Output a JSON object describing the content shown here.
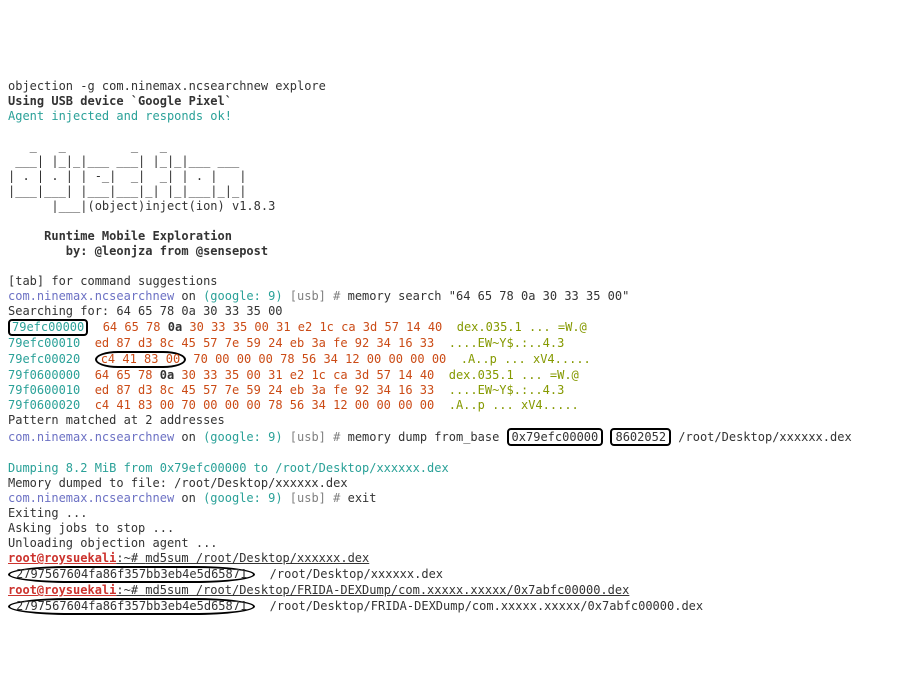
{
  "cmd_line": "objection -g com.ninemax.ncsearchnew explore",
  "usb_device": "Using USB device `Google Pixel`",
  "agent_ok": "Agent injected and responds ok!",
  "ascii": [
    "   _   _         _   _",
    " ___| |_|_|___ ___| |_|_|___ ___",
    "| . | . | | -_|  _|  _| | . |   |",
    "|___|___| |___|___|_| |_|___|_|_|",
    "      |___|(object)inject(ion) v1.8.3"
  ],
  "runtime_title": "     Runtime Mobile Exploration",
  "byline": "        by: @leonjza from @sensepost",
  "tab_hint": "[tab] for command suggestions",
  "app_pkg": "com.ninemax.ncsearchnew",
  "on_text": " on ",
  "google_text": "(google: 9)",
  "usb_text": " [usb] # ",
  "cmd_search": "memory search \"64 65 78 0a 30 33 35 00\"",
  "searching_for": "Searching for: 64 65 78 0a 30 33 35 00",
  "hex_rows": [
    {
      "addr": "79efc00000",
      "hex": "64 65 78 0a 30 33 35 00 31 e2 1c ca 3d 57 14 40",
      "ascii": "dex.035.1 ... =W.@",
      "bold_idx": 3,
      "box_addr": true
    },
    {
      "addr": "79efc00010",
      "hex": "ed 87 d3 8c 45 57 7e 59 24 eb 3a fe 92 34 16 33",
      "ascii": "....EW~Y$.:..4.3"
    },
    {
      "addr": "79efc00020",
      "hex_pre": "c4 41 83 00",
      "hex_rest": " 70 00 00 00 78 56 34 12 00 00 00 00",
      "ascii": ".A..p ... xV4.....",
      "circle_hex": true
    },
    {
      "addr": "79f0600000",
      "hex": "64 65 78 0a 30 33 35 00 31 e2 1c ca 3d 57 14 40",
      "ascii": "dex.035.1 ... =W.@",
      "bold_idx": 3
    },
    {
      "addr": "79f0600010",
      "hex": "ed 87 d3 8c 45 57 7e 59 24 eb 3a fe 92 34 16 33",
      "ascii": "....EW~Y$.:..4.3"
    },
    {
      "addr": "79f0600020",
      "hex": "c4 41 83 00 70 00 00 00 78 56 34 12 00 00 00 00",
      "ascii": ".A..p ... xV4....."
    }
  ],
  "pattern_matched": "Pattern matched at 2 addresses",
  "cmd_dump_prefix": "memory dump from_base ",
  "dump_addr": "0x79efc00000",
  "dump_size": "8602052",
  "dump_path": " /root/Desktop/xxxxxx.dex",
  "dumping_msg": "Dumping 8.2 MiB from 0x79efc00000 to /root/Desktop/xxxxxx.dex",
  "memory_dumped_msg": "Memory dumped to file: /root/Desktop/xxxxxx.dex",
  "cmd_exit": "exit",
  "exiting": "Exiting ...",
  "asking": "Asking jobs to stop ...",
  "unloading": "Unloading objection agent ...",
  "prompt_user": "root@roysuekali",
  "prompt_sep": ":~# ",
  "md5_cmd1": "md5sum /root/Desktop/xxxxxx.dex",
  "md5_hash": "2797567604fa86f357bb3eb4e5d65871",
  "md5_file1": "/root/Desktop/xxxxxx.dex",
  "md5_cmd2": "md5sum /root/Desktop/FRIDA-DEXDump/com.xxxxx.xxxxx/0x7abfc00000.dex",
  "md5_file2": "/root/Desktop/FRIDA-DEXDump/com.xxxxx.xxxxx/0x7abfc00000.dex"
}
